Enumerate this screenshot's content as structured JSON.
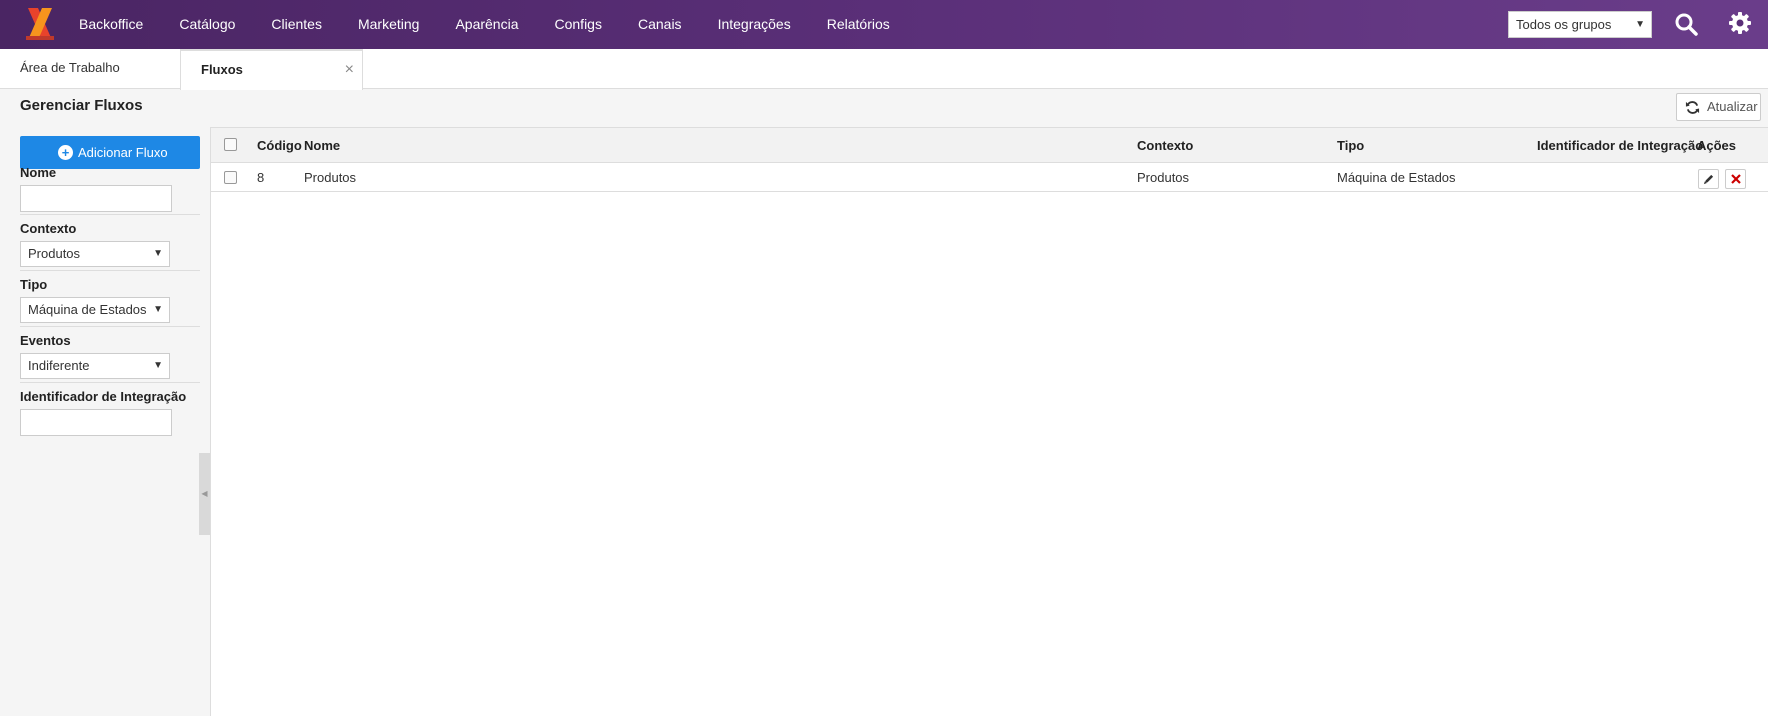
{
  "nav": {
    "items": [
      "Backoffice",
      "Catálogo",
      "Clientes",
      "Marketing",
      "Aparência",
      "Configs",
      "Canais",
      "Integrações",
      "Relatórios"
    ],
    "group_select": "Todos os grupos"
  },
  "tabs": [
    {
      "label": "Área de Trabalho"
    },
    {
      "label": "Fluxos",
      "close": "×"
    }
  ],
  "page": {
    "title": "Gerenciar Fluxos",
    "refresh_label": "Atualizar"
  },
  "sidebar": {
    "add_label": "Adicionar Fluxo",
    "filters": {
      "nome": {
        "label": "Nome",
        "value": ""
      },
      "contexto": {
        "label": "Contexto",
        "value": "Produtos"
      },
      "tipo": {
        "label": "Tipo",
        "value": "Máquina de Estados"
      },
      "eventos": {
        "label": "Eventos",
        "value": "Indiferente"
      },
      "identificador": {
        "label": "Identificador de Integração",
        "value": ""
      }
    }
  },
  "grid": {
    "columns": {
      "codigo": "Código",
      "nome": "Nome",
      "contexto": "Contexto",
      "tipo": "Tipo",
      "identificador": "Identificador de Integração",
      "acoes": "Ações"
    },
    "rows": [
      {
        "codigo": "8",
        "nome": "Produtos",
        "contexto": "Produtos",
        "tipo": "Máquina de Estados",
        "identificador": ""
      }
    ]
  },
  "colors": {
    "topbar": "#4a2563",
    "primary": "#1e88e5",
    "delete": "#cc0000"
  }
}
